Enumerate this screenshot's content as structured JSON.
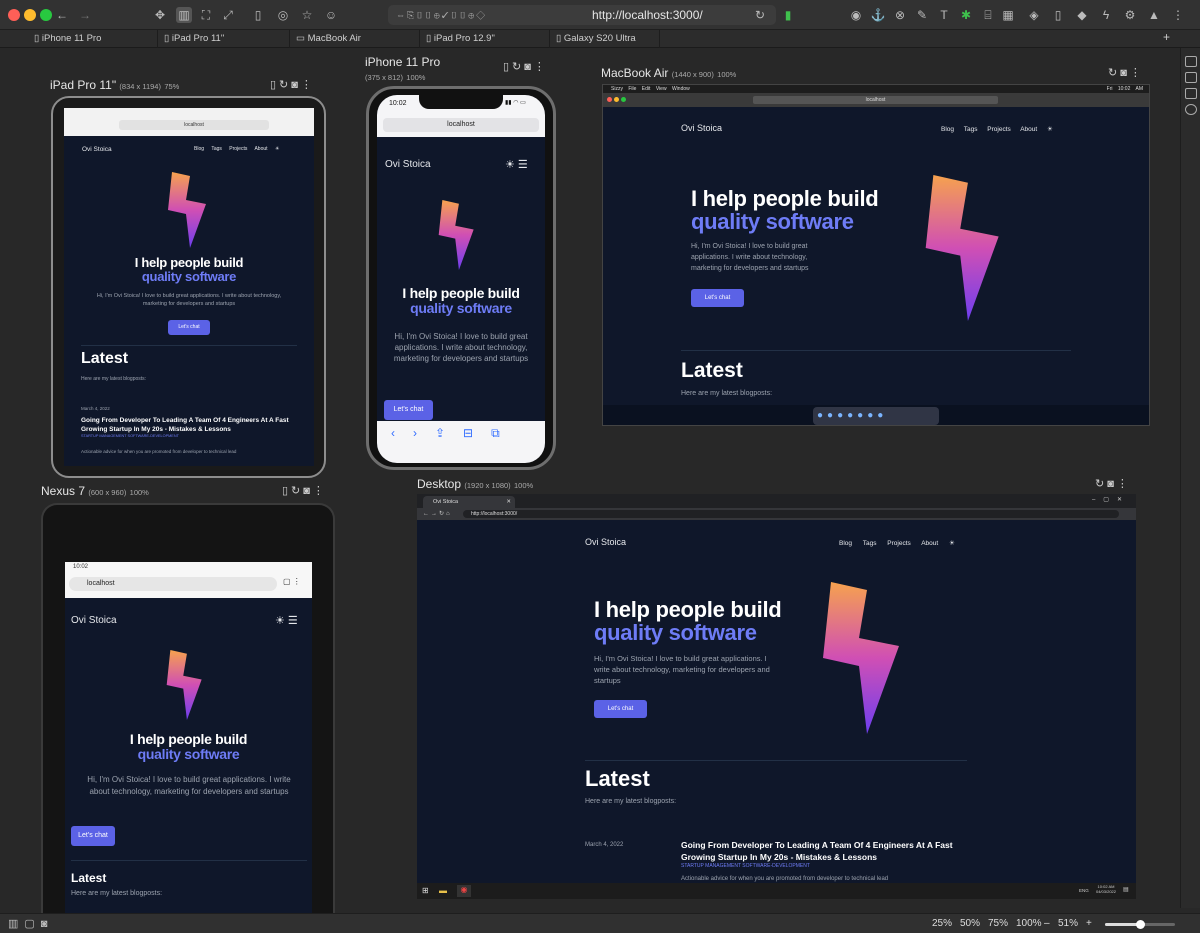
{
  "app": {
    "url": "http://localhost:3000/"
  },
  "tabs": [
    "iPhone 11 Pro",
    "iPad Pro 11\"",
    "MacBook Air",
    "iPad Pro 12.9\"",
    "Galaxy S20 Ultra"
  ],
  "zoom": {
    "levels": [
      "25%",
      "50%",
      "75%",
      "100%"
    ],
    "current": "51%",
    "minus": "–",
    "plus": "+"
  },
  "devices": {
    "ipad11": {
      "name": "iPad Pro 11\"",
      "size": "(834 x 1194)",
      "scale": "75%"
    },
    "iphone": {
      "name": "iPhone 11 Pro",
      "size": "(375 x 812)",
      "scale": "100%"
    },
    "macbook": {
      "name": "MacBook Air",
      "size": "(1440 x 900)",
      "scale": "100%"
    },
    "nexus": {
      "name": "Nexus 7",
      "size": "(600 x 960)",
      "scale": "100%"
    },
    "desktop": {
      "name": "Desktop",
      "size": "(1920 x 1080)",
      "scale": "100%"
    }
  },
  "site": {
    "brand": "Ovi Stoica",
    "nav": [
      "Blog",
      "Tags",
      "Projects",
      "About"
    ],
    "sun": "☀",
    "h1a": "I help people build",
    "h1b": "quality software",
    "intro": "Hi, I'm Ovi Stoica! I love to build great applications. I write about technology, marketing for developers and startups",
    "cta": "Let's chat",
    "latest": "Latest",
    "latest_sub": "Here are my latest blogposts:",
    "post": {
      "date": "March 4, 2022",
      "title": "Going From Developer To Leading A Team Of 4 Engineers At A Fast Growing Startup In My 20s - Mistakes & Lessons",
      "tags": "STARTUP  MANAGEMENT  SOFTWARE-DEVELOPMENT",
      "summary": "Actionable advice for when you are promoted from developer to technical lead"
    }
  },
  "ios": {
    "time": "10:02",
    "address": "localhost"
  },
  "android": {
    "time": "10:02",
    "address": "localhost"
  },
  "mac_menu": [
    "Sizzy",
    "File",
    "Edit",
    "View",
    "Window"
  ],
  "mac_clock": "Fri 10:02 AM",
  "mac_address": "localhost",
  "win": {
    "tab": "Ovi Stoica",
    "url": "http://localhost:3000/",
    "lang": "ENG",
    "time": "10:02 AM",
    "date": "04/03/2022"
  }
}
